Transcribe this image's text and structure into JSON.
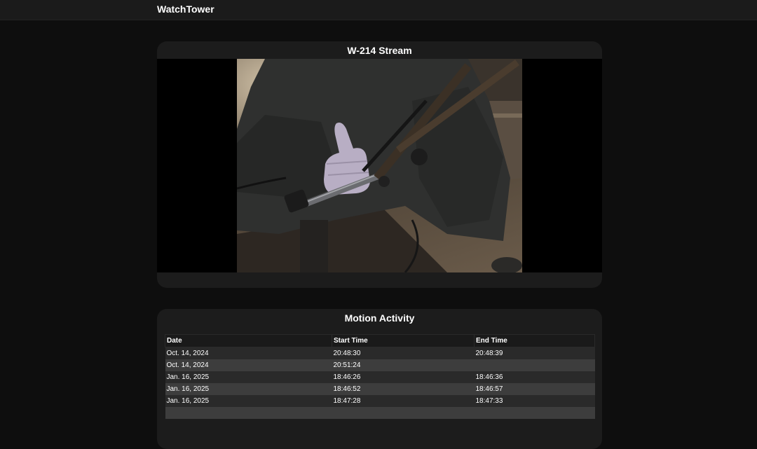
{
  "header": {
    "brand": "WatchTower"
  },
  "stream": {
    "title": "W-214 Stream"
  },
  "activity": {
    "title": "Motion Activity",
    "columns": [
      "Date",
      "Start Time",
      "End Time"
    ],
    "rows": [
      {
        "date": "Oct. 14, 2024",
        "start": "20:48:30",
        "end": "20:48:39"
      },
      {
        "date": "Oct. 14, 2024",
        "start": "20:51:24",
        "end": ""
      },
      {
        "date": "Jan. 16, 2025",
        "start": "18:46:26",
        "end": "18:46:36"
      },
      {
        "date": "Jan. 16, 2025",
        "start": "18:46:52",
        "end": "18:46:57"
      },
      {
        "date": "Jan. 16, 2025",
        "start": "18:47:28",
        "end": "18:47:33"
      },
      {
        "date": "",
        "start": "",
        "end": ""
      }
    ]
  }
}
